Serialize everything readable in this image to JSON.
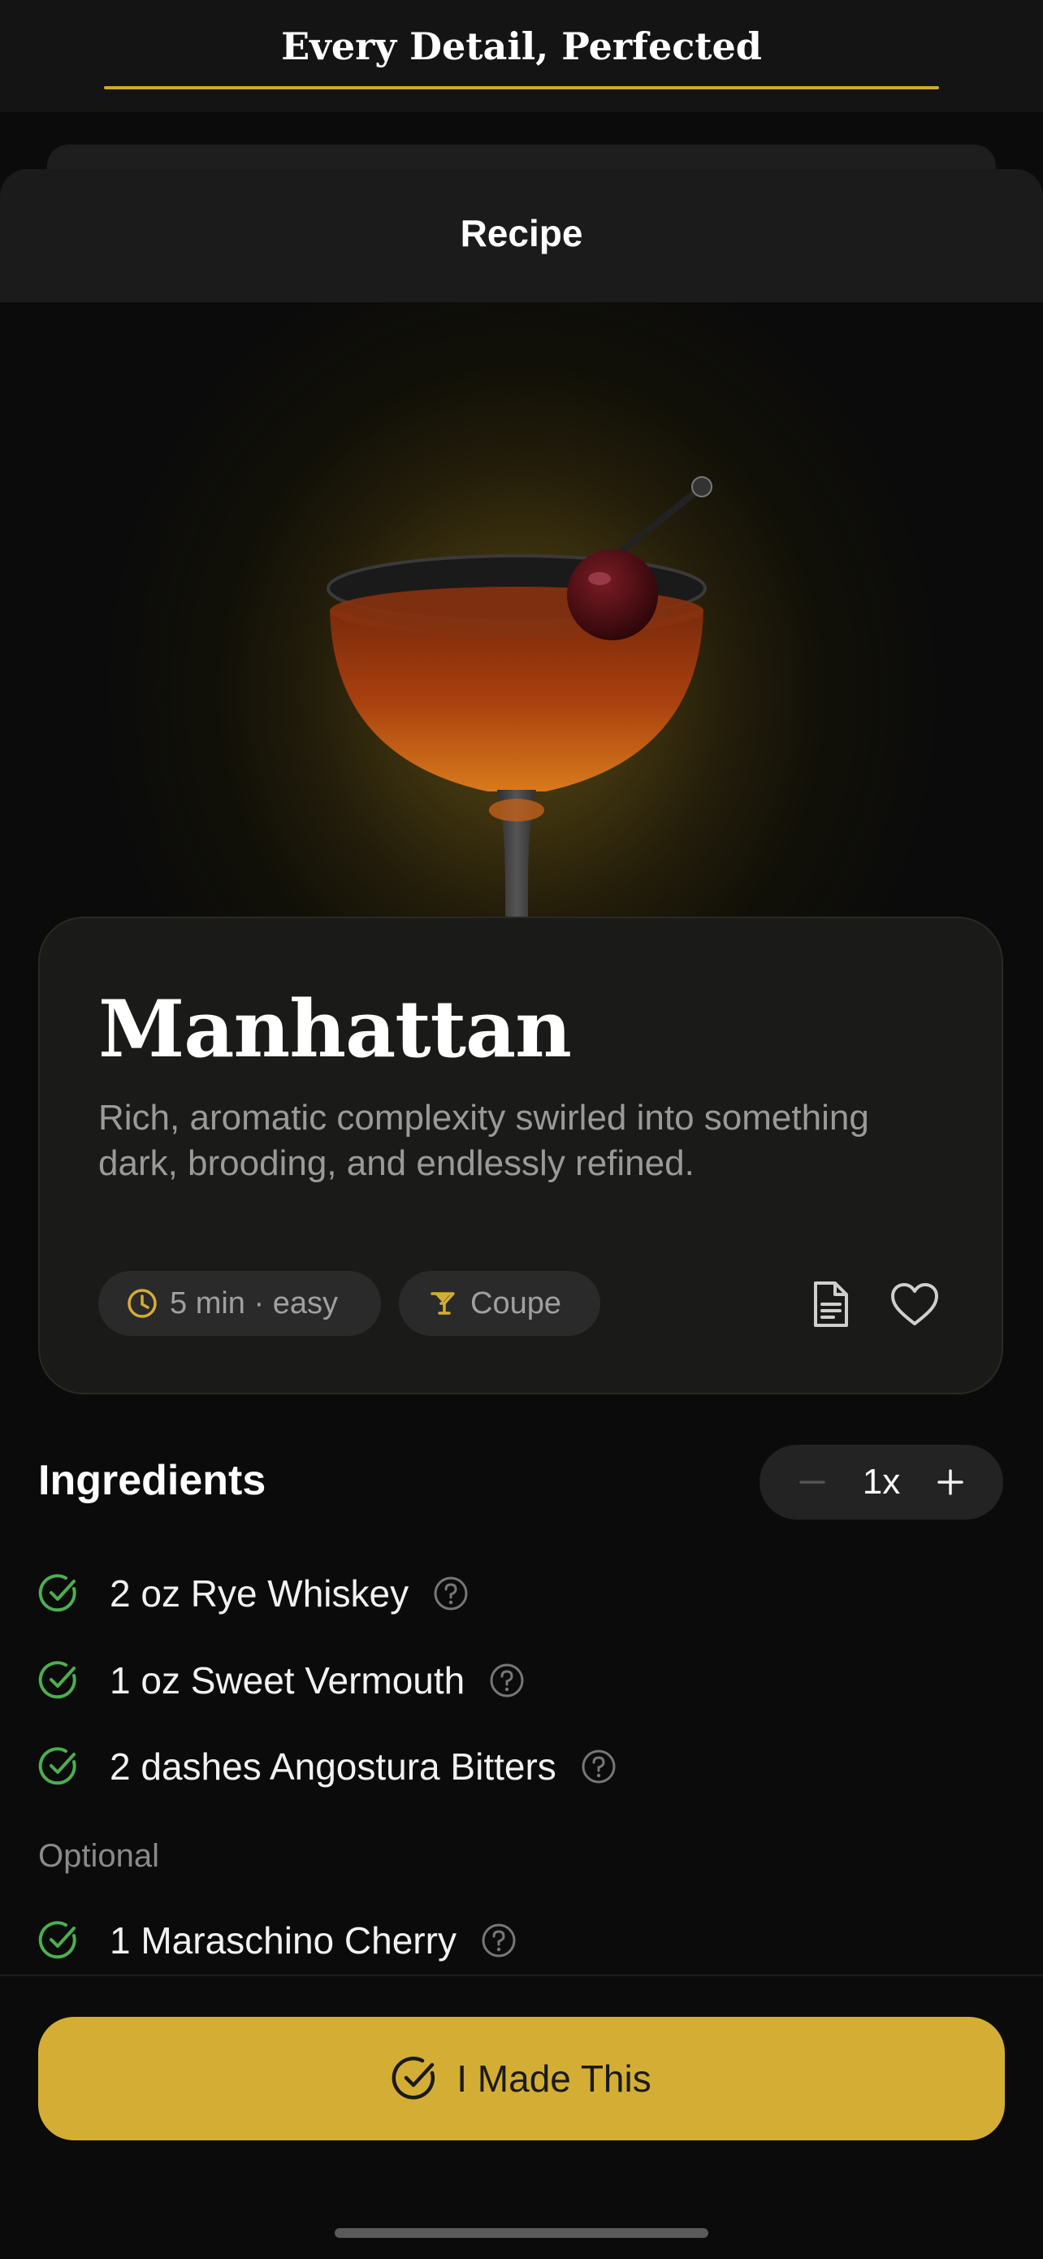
{
  "banner": {
    "title": "Every Detail, Perfected"
  },
  "sheet": {
    "title": "Recipe"
  },
  "drink": {
    "name": "Manhattan",
    "description": "Rich, aromatic complexity swirled into something dark, brooding, and endlessly refined.",
    "time_chip": "5 min · easy",
    "glass_chip": "Coupe"
  },
  "ingredients": {
    "title": "Ingredients",
    "multiplier": "1x",
    "minus_icon": "minus-icon",
    "plus_icon": "plus-icon",
    "required": [
      {
        "label": "2 oz Rye Whiskey"
      },
      {
        "label": "1 oz Sweet Vermouth"
      },
      {
        "label": "2 dashes Angostura Bitters"
      }
    ],
    "optional_label": "Optional",
    "optional": [
      {
        "label": "1 Maraschino Cherry"
      }
    ]
  },
  "action": {
    "made_label": "I Made This"
  },
  "colors": {
    "accent": "#d4ae34",
    "check": "#4caf50",
    "background": "#0b0b0b",
    "card": "#1a1a19"
  }
}
